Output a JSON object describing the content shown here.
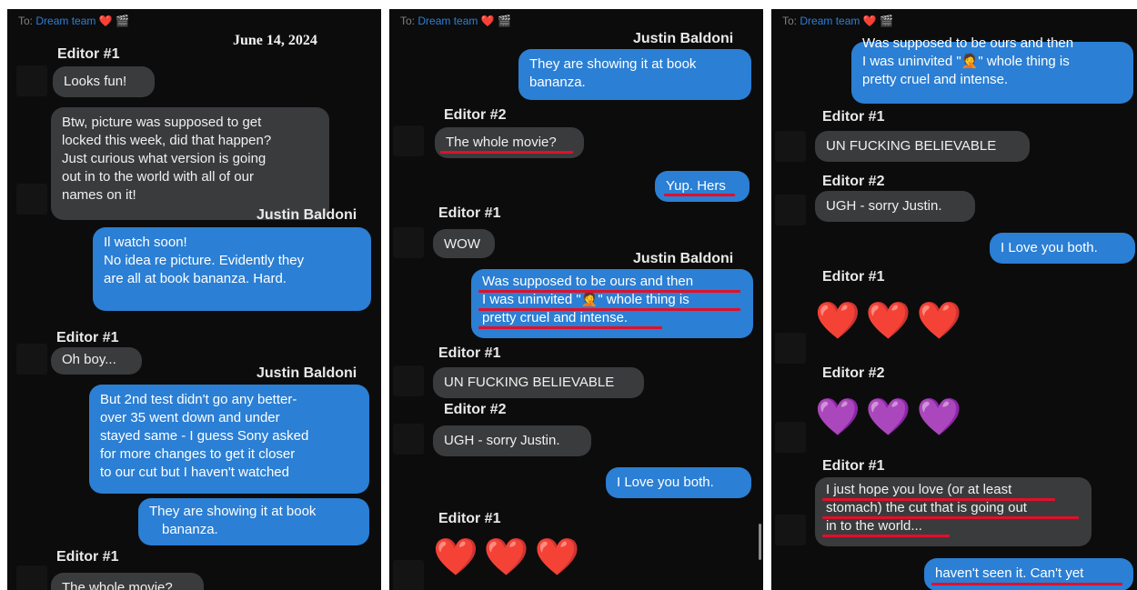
{
  "header": {
    "to_label": "To:",
    "recipient": "Dream team",
    "heart": "❤️",
    "camera": "🎬"
  },
  "date": "June 14, 2024",
  "names": {
    "editor1": "Editor #1",
    "editor2": "Editor #2",
    "justin": "Justin Baldoni"
  },
  "panel1": {
    "m1": "Looks fun!",
    "m2": [
      "Btw, picture was supposed to get",
      "locked this week, did that happen?",
      "Just curious what version is going",
      "out in to the world with all of our",
      "names on it!"
    ],
    "m3": [
      "Il watch soon!",
      "No idea re picture. Evidently they",
      "are all at book bananza. Hard."
    ],
    "m4": "Oh boy...",
    "m5": [
      "But 2nd test didn't go any better-",
      "over 35 went down and under",
      "stayed same - I guess Sony asked",
      "for more changes to get it closer",
      "to our cut but I haven't watched"
    ],
    "m6": [
      "They are showing it at book",
      "bananza."
    ],
    "m7": "The whole movie?"
  },
  "panel2": {
    "m1": [
      "They are showing it at book",
      "bananza."
    ],
    "m2": "The whole movie?",
    "m3": "Yup. Hers",
    "m4": "WOW",
    "m5": [
      "Was supposed to be ours and then",
      "I was uninvited \"🤦\" whole thing is",
      "pretty cruel and intense."
    ],
    "m6": "UN FUCKING BELIEVABLE",
    "m7": "UGH - sorry Justin.",
    "m8": "I Love you both.",
    "hearts": [
      "❤️",
      "❤️",
      "❤️"
    ]
  },
  "panel3": {
    "m1": [
      "Was supposed to be ours and then",
      "I was uninvited \"🤦\" whole thing is",
      "pretty cruel and intense."
    ],
    "m2": "UN FUCKING BELIEVABLE",
    "m3": "UGH - sorry Justin.",
    "m4": "I Love you both.",
    "red_hearts": [
      "❤️",
      "❤️",
      "❤️"
    ],
    "purple_hearts": [
      "💜",
      "💜",
      "💜"
    ],
    "m5": [
      "I just hope you love (or at least",
      "stomach) the cut that is going out",
      "in to the world..."
    ],
    "m6": "haven't seen it. Can't yet"
  }
}
